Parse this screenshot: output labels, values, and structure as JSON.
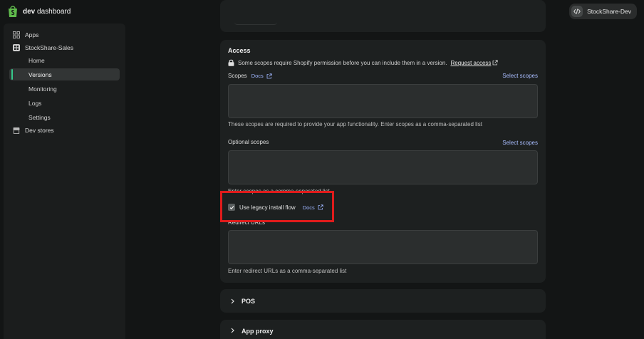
{
  "header": {
    "brand_bold": "dev",
    "brand_rest": " dashboard",
    "store_name": "StockShare-Dev"
  },
  "sidebar": {
    "apps": "Apps",
    "app_name": "StockShare-Sales",
    "sub_items": [
      "Home",
      "Versions",
      "Monitoring",
      "Logs",
      "Settings"
    ],
    "active": "Versions",
    "dev_stores": "Dev stores"
  },
  "access": {
    "title": "Access",
    "notice": "Some scopes require Shopify permission before you can include them in a version.",
    "request_access": "Request access",
    "scopes_label": "Scopes",
    "docs": "Docs",
    "select_scopes": "Select scopes",
    "scopes_value": "",
    "scopes_help": "These scopes are required to provide your app functionality. Enter scopes as a comma-separated list",
    "optional_label": "Optional scopes",
    "optional_value": "",
    "optional_help": "Enter scopes as a comma-separated list",
    "legacy_label": "Use legacy install flow",
    "legacy_checked": true,
    "redirect_label": "Redirect URLs",
    "redirect_value": "",
    "redirect_help": "Enter redirect URLs as a comma-separated list"
  },
  "sections": {
    "pos": "POS",
    "app_proxy": "App proxy"
  },
  "colors": {
    "accent_green": "#36c98b",
    "link_blue": "#a9bdff",
    "highlight_red": "#e01b1b"
  }
}
